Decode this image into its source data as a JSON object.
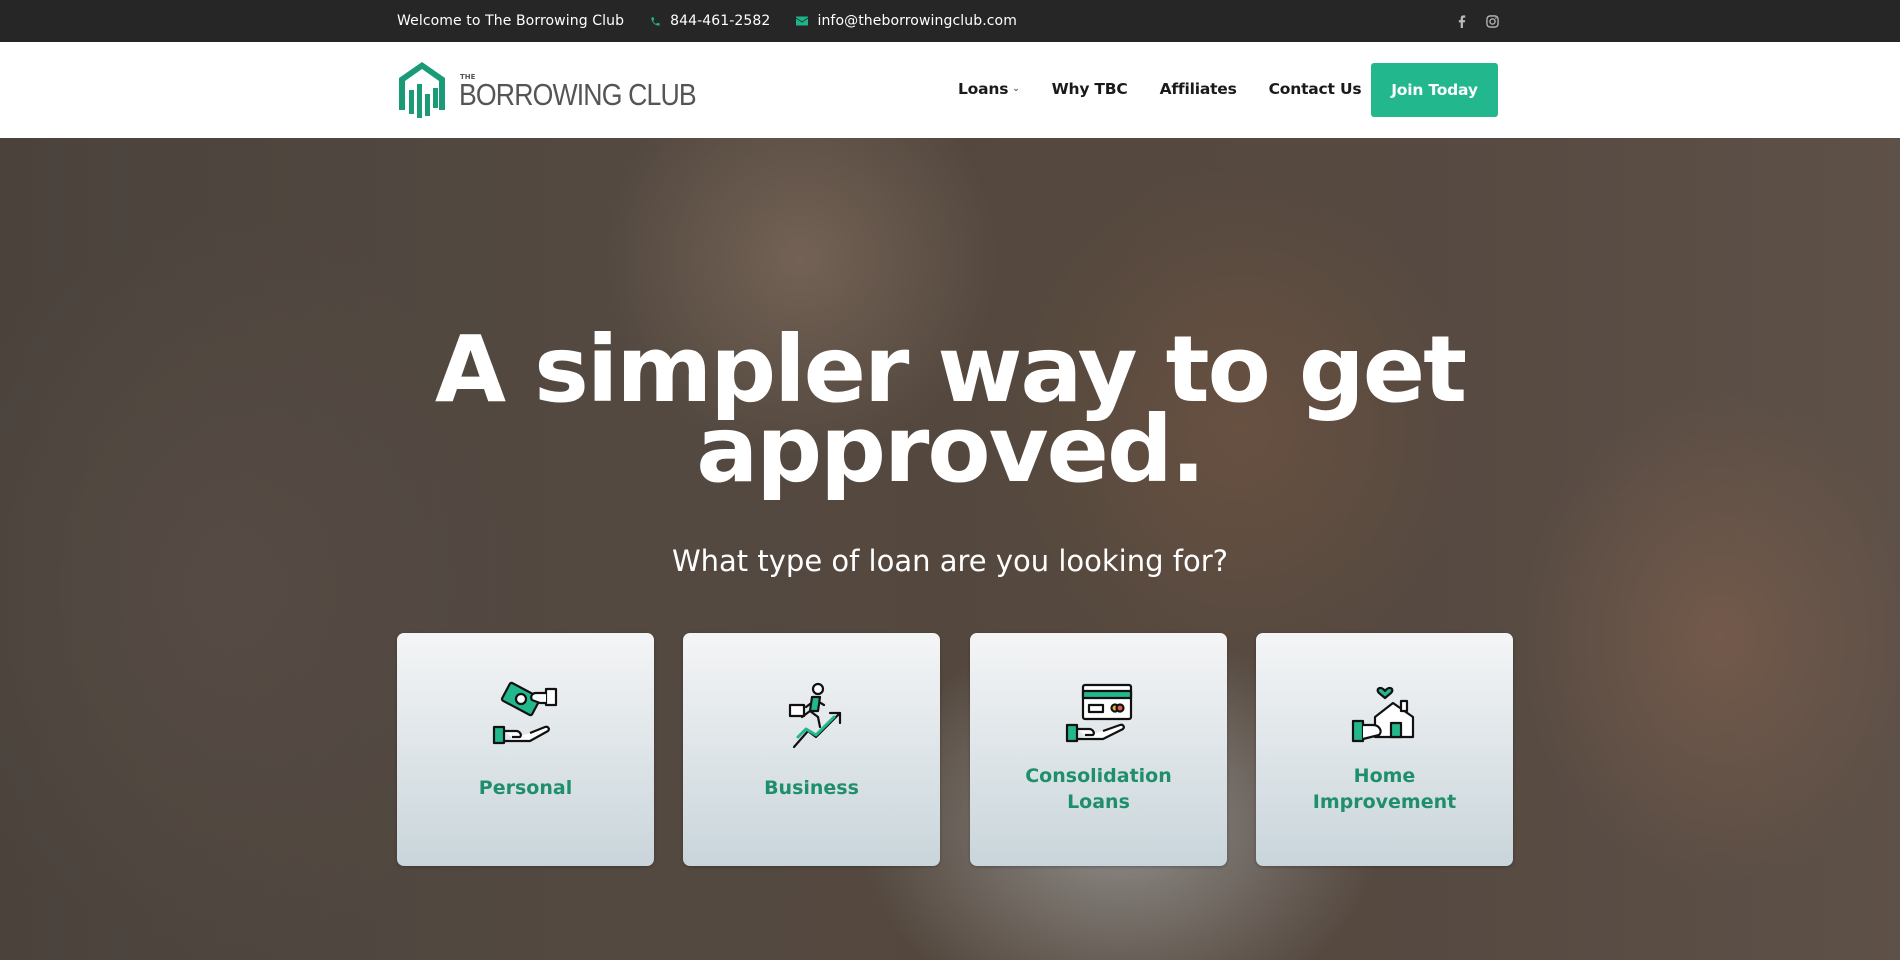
{
  "topbar": {
    "welcome": "Welcome to The Borrowing Club",
    "phone": "844-461-2582",
    "email": "info@theborrowingclub.com",
    "social": [
      "facebook-icon",
      "instagram-icon"
    ]
  },
  "header": {
    "logo_the": "THE",
    "logo_name": "BORROWING CLUB",
    "nav": [
      {
        "label": "Loans",
        "has_dropdown": true
      },
      {
        "label": "Why TBC"
      },
      {
        "label": "Affiliates"
      },
      {
        "label": "Contact Us"
      }
    ],
    "cta": "Join Today"
  },
  "hero": {
    "headline_line1": "A simpler way to get",
    "headline_line2": "approved.",
    "subhead": "What type of loan are you looking for?",
    "cards": [
      {
        "label": "Personal",
        "icon": "hand-money-icon"
      },
      {
        "label": "Business",
        "icon": "business-growth-icon"
      },
      {
        "label_line1": "Consolidation",
        "label_line2": "Loans",
        "icon": "hand-card-icon"
      },
      {
        "label_line1": "Home",
        "label_line2": "Improvement",
        "icon": "hand-house-icon"
      }
    ]
  },
  "colors": {
    "accent": "#22b78c",
    "card_text": "#1f8f6b",
    "topbar_bg": "#262626"
  }
}
